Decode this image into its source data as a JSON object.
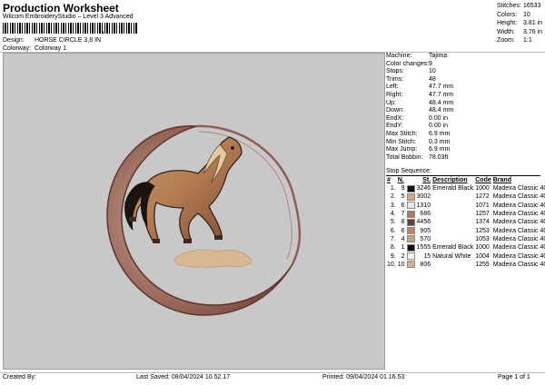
{
  "header": {
    "title": "Production Worksheet",
    "subtitle": "Wilcom EmbroideryStudio – Level 3 Advanced",
    "design_label": "Design:",
    "design_value": "HORSE CIRCLE 3,8 IN",
    "colorway_label": "Colorway:",
    "colorway_value": "Colorway 1"
  },
  "stats": [
    {
      "label": "Stitches:",
      "value": "16533"
    },
    {
      "label": "Colors:",
      "value": "10"
    },
    {
      "label": "Height:",
      "value": "3.81 in"
    },
    {
      "label": "Width:",
      "value": "3.76 in"
    },
    {
      "label": "Zoom:",
      "value": "1:1"
    }
  ],
  "info": [
    {
      "label": "Machine:",
      "value": "Tajima"
    },
    {
      "label": "Color changes:",
      "value": "9"
    },
    {
      "label": "Stops:",
      "value": "10"
    },
    {
      "label": "Trims:",
      "value": "48"
    },
    {
      "label": "Left:",
      "value": "47.7 mm"
    },
    {
      "label": "Right:",
      "value": "47.7 mm"
    },
    {
      "label": "Up:",
      "value": "48.4 mm"
    },
    {
      "label": "Down:",
      "value": "48.4 mm"
    },
    {
      "label": "EndX:",
      "value": "0.00 in"
    },
    {
      "label": "EndY:",
      "value": "0.00 in"
    },
    {
      "label": "Max Stitch:",
      "value": "6.9 mm"
    },
    {
      "label": "Min Stitch:",
      "value": "0.3 mm"
    },
    {
      "label": "Max Jump:",
      "value": "6.9 mm"
    },
    {
      "label": "Total Bobbin:",
      "value": "78.03ft"
    }
  ],
  "sequence": {
    "title": "Stop Sequence:",
    "columns": [
      "#",
      "N.",
      "St.",
      "Description",
      "Code",
      "Brand"
    ],
    "rows": [
      {
        "n": "1.",
        "needle": "9",
        "color": "#111111",
        "st": "3246",
        "desc": "Emerald Black",
        "code": "1000",
        "brand": "Madeira Classic 40"
      },
      {
        "n": "2.",
        "needle": "5",
        "color": "#d8a77c",
        "st": "3002",
        "desc": "",
        "code": "1272",
        "brand": "Madeira Classic 40"
      },
      {
        "n": "3.",
        "needle": "6",
        "color": "#ece6dc",
        "st": "1310",
        "desc": "",
        "code": "1071",
        "brand": "Madeira Classic 40"
      },
      {
        "n": "4.",
        "needle": "7",
        "color": "#b07a58",
        "st": "686",
        "desc": "",
        "code": "1257",
        "brand": "Madeira Classic 40"
      },
      {
        "n": "5.",
        "needle": "8",
        "color": "#6b3f35",
        "st": "4456",
        "desc": "",
        "code": "1374",
        "brand": "Madeira Classic 40"
      },
      {
        "n": "6.",
        "needle": "6",
        "color": "#c57f60",
        "st": "905",
        "desc": "",
        "code": "1253",
        "brand": "Madeira Classic 40"
      },
      {
        "n": "7.",
        "needle": "4",
        "color": "#c9a17d",
        "st": "570",
        "desc": "",
        "code": "1053",
        "brand": "Madeira Classic 40"
      },
      {
        "n": "8.",
        "needle": "1",
        "color": "#111111",
        "st": "1555",
        "desc": "Emerald Black",
        "code": "1000",
        "brand": "Madeira Classic 40"
      },
      {
        "n": "9.",
        "needle": "2",
        "color": "#f4f1ea",
        "st": "15",
        "desc": "Natural White",
        "code": "1004",
        "brand": "Madeira Classic 40"
      },
      {
        "n": "10.",
        "needle": "10",
        "color": "#d8b28d",
        "st": "806",
        "desc": "",
        "code": "1255",
        "brand": "Madeira Classic 40"
      }
    ]
  },
  "footer": {
    "created": "Created By:",
    "saved": "Last Saved: 08/04/2024 10.52.17",
    "printed": "Printed: 09/04/2024 01.16.53",
    "page": "Page 1 of 1"
  }
}
